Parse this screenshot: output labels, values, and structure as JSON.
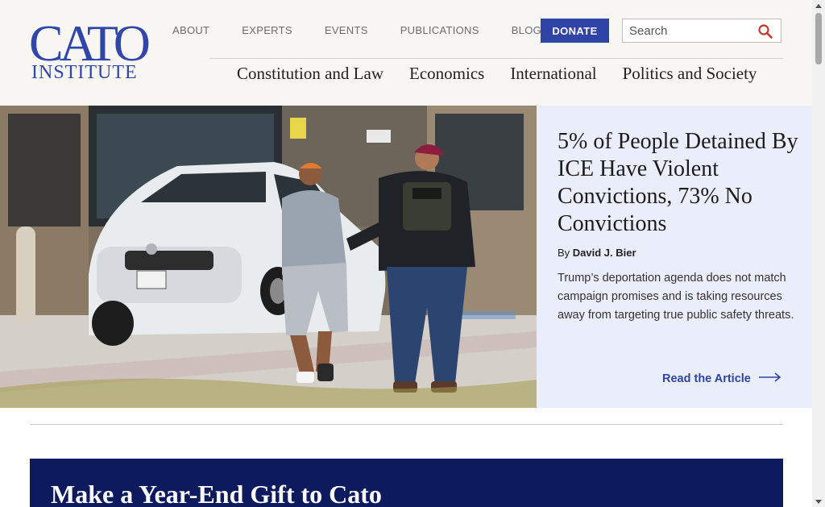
{
  "logo": {
    "main": "CATO",
    "sub": "INSTITUTE"
  },
  "utility_nav": [
    "ABOUT",
    "EXPERTS",
    "EVENTS",
    "PUBLICATIONS",
    "BLOG"
  ],
  "donate_label": "DONATE",
  "search": {
    "placeholder": "Search",
    "icon": "search-icon"
  },
  "main_nav": [
    "Constitution and Law",
    "Economics",
    "International",
    "Politics and Society"
  ],
  "hero": {
    "title": "5% of People Detained By ICE Have Violent Convictions, 73% No Convictions",
    "byline_prefix": "By",
    "author": "David J. Bier",
    "description": "Trump’s deportation agenda does not match campaign promises and is taking resources away from targeting true public safety threats.",
    "link_label": "Read the Article",
    "link_icon": "arrow-right-icon"
  },
  "promo": {
    "title": "Make a Year-End Gift to Cato"
  },
  "colors": {
    "brand_blue": "#2f44a5",
    "logo_blue": "#3046a8",
    "panel_bg": "#eaeefb",
    "promo_bg": "#0e1a5e",
    "header_bg": "#f7f6f3"
  }
}
